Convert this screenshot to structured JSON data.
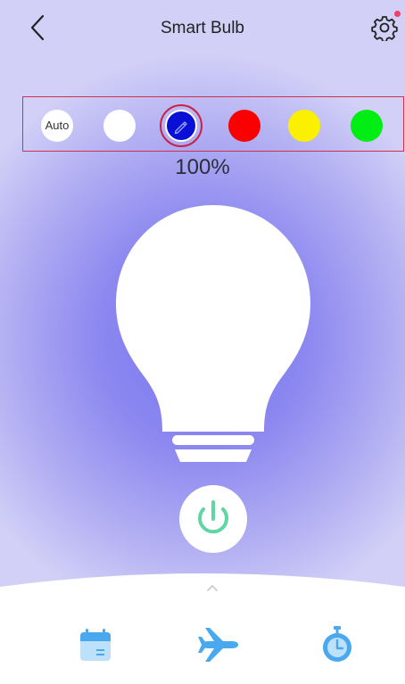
{
  "header": {
    "title": "Smart Bulb"
  },
  "color_options": {
    "auto_label": "Auto",
    "swatches": [
      {
        "id": "auto",
        "color": "#ffffff"
      },
      {
        "id": "white",
        "color": "#ffffff"
      },
      {
        "id": "blue",
        "color": "#0a0fd6",
        "selected": true,
        "icon": "pencil-icon"
      },
      {
        "id": "red",
        "color": "#fb0000"
      },
      {
        "id": "yellow",
        "color": "#fbf000"
      },
      {
        "id": "green",
        "color": "#00ee14"
      }
    ]
  },
  "brightness": {
    "value": "100%"
  },
  "power": {
    "icon": "power-icon",
    "accent": "#5fd6a4"
  },
  "bottom_nav": {
    "items": [
      {
        "icon": "calendar-icon"
      },
      {
        "icon": "airplane-icon"
      },
      {
        "icon": "timer-icon"
      }
    ]
  },
  "colors": {
    "accent_blue": "#4aa8ef",
    "notification": "#f0406a"
  }
}
